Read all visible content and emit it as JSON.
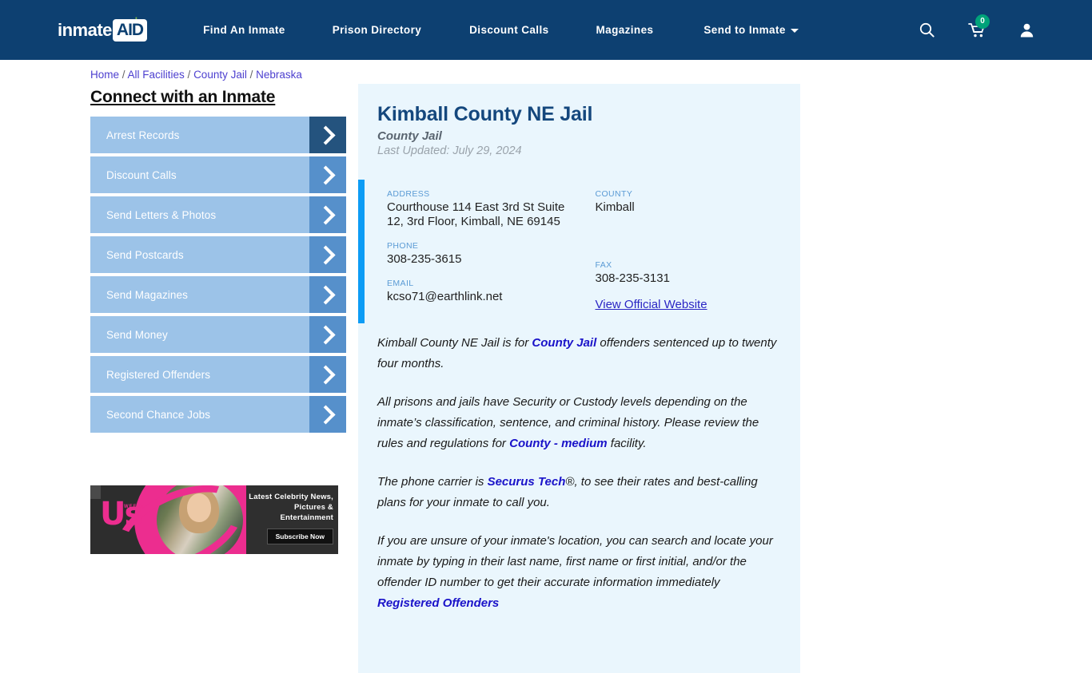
{
  "header": {
    "brand": {
      "word": "inmate",
      "box": "AID",
      "plus": "+"
    },
    "nav": [
      {
        "label": "Find An Inmate",
        "name": "nav-find-an-inmate"
      },
      {
        "label": "Prison Directory",
        "name": "nav-prison-directory"
      },
      {
        "label": "Discount Calls",
        "name": "nav-discount-calls"
      },
      {
        "label": "Magazines",
        "name": "nav-magazines"
      },
      {
        "label": "Send to Inmate",
        "name": "nav-send-to-inmate",
        "has_caret": true
      }
    ],
    "icons": {
      "search": "search-icon",
      "cart": "cart-icon",
      "account": "account-icon"
    },
    "cart_count": "0",
    "colors": {
      "header_bg": "#0d4071",
      "cart_badge": "#00a37a",
      "brand_plus": "#7ab648"
    }
  },
  "breadcrumb": {
    "items": [
      "Home",
      "All Facilities",
      "County Jail",
      "Nebraska"
    ],
    "separator": "/"
  },
  "sidebar": {
    "title": "Connect with an Inmate",
    "items": [
      {
        "label": "Arrest Records",
        "active": true
      },
      {
        "label": "Discount Calls",
        "active": false
      },
      {
        "label": "Send Letters & Photos",
        "active": false
      },
      {
        "label": "Send Postcards",
        "active": false
      },
      {
        "label": "Send Magazines",
        "active": false
      },
      {
        "label": "Send Money",
        "active": false
      },
      {
        "label": "Registered Offenders",
        "active": false
      },
      {
        "label": "Second Chance Jobs",
        "active": false
      }
    ],
    "colors": {
      "button_bg": "#9cc3e8",
      "arrow_bg": "#5690cb",
      "arrow_bg_active": "#24537e"
    }
  },
  "ad": {
    "logo": "Us",
    "logo_sub": "WEEKLY",
    "headline": "Latest Celebrity News, Pictures & Entertainment",
    "cta": "Subscribe Now",
    "accent_color": "#ec2d8f"
  },
  "facility": {
    "name": "Kimball County NE Jail",
    "type": "County Jail",
    "last_updated": "Last Updated: July 29, 2024",
    "fields": {
      "address_label": "ADDRESS",
      "address_value": "Courthouse 114 East 3rd St Suite 12, 3rd Floor, Kimball, NE 69145",
      "county_label": "COUNTY",
      "county_value": "Kimball",
      "phone_label": "PHONE",
      "phone_value": "308-235-3615",
      "fax_label": "FAX",
      "fax_value": "308-235-3131",
      "email_label": "EMAIL",
      "email_value": "kcso71@earthlink.net",
      "website_link": "View Official Website"
    },
    "accent_bar_color": "#0d9cf5",
    "panel_bg": "#eaf6fd"
  },
  "body": {
    "p1_a": "Kimball County NE Jail is for ",
    "p1_link": "County Jail",
    "p1_b": " offenders sentenced up to twenty four months.",
    "p2_a": "All prisons and jails have Security or Custody levels depending on the inmate’s classification, sentence, and criminal history. Please review the rules and regulations for ",
    "p2_link": "County - medium",
    "p2_b": " facility.",
    "p3_a": "The phone carrier is ",
    "p3_link": "Securus Tech",
    "p3_reg": "®",
    "p3_b": ", to see their rates and best-calling plans for your inmate to call you.",
    "p4_a": "If you are unsure of your inmate's location, you can search and locate your inmate by typing in their last name, first name or first initial, and/or the offender ID number to get their accurate information immediately ",
    "p4_link": "Registered Offenders"
  }
}
